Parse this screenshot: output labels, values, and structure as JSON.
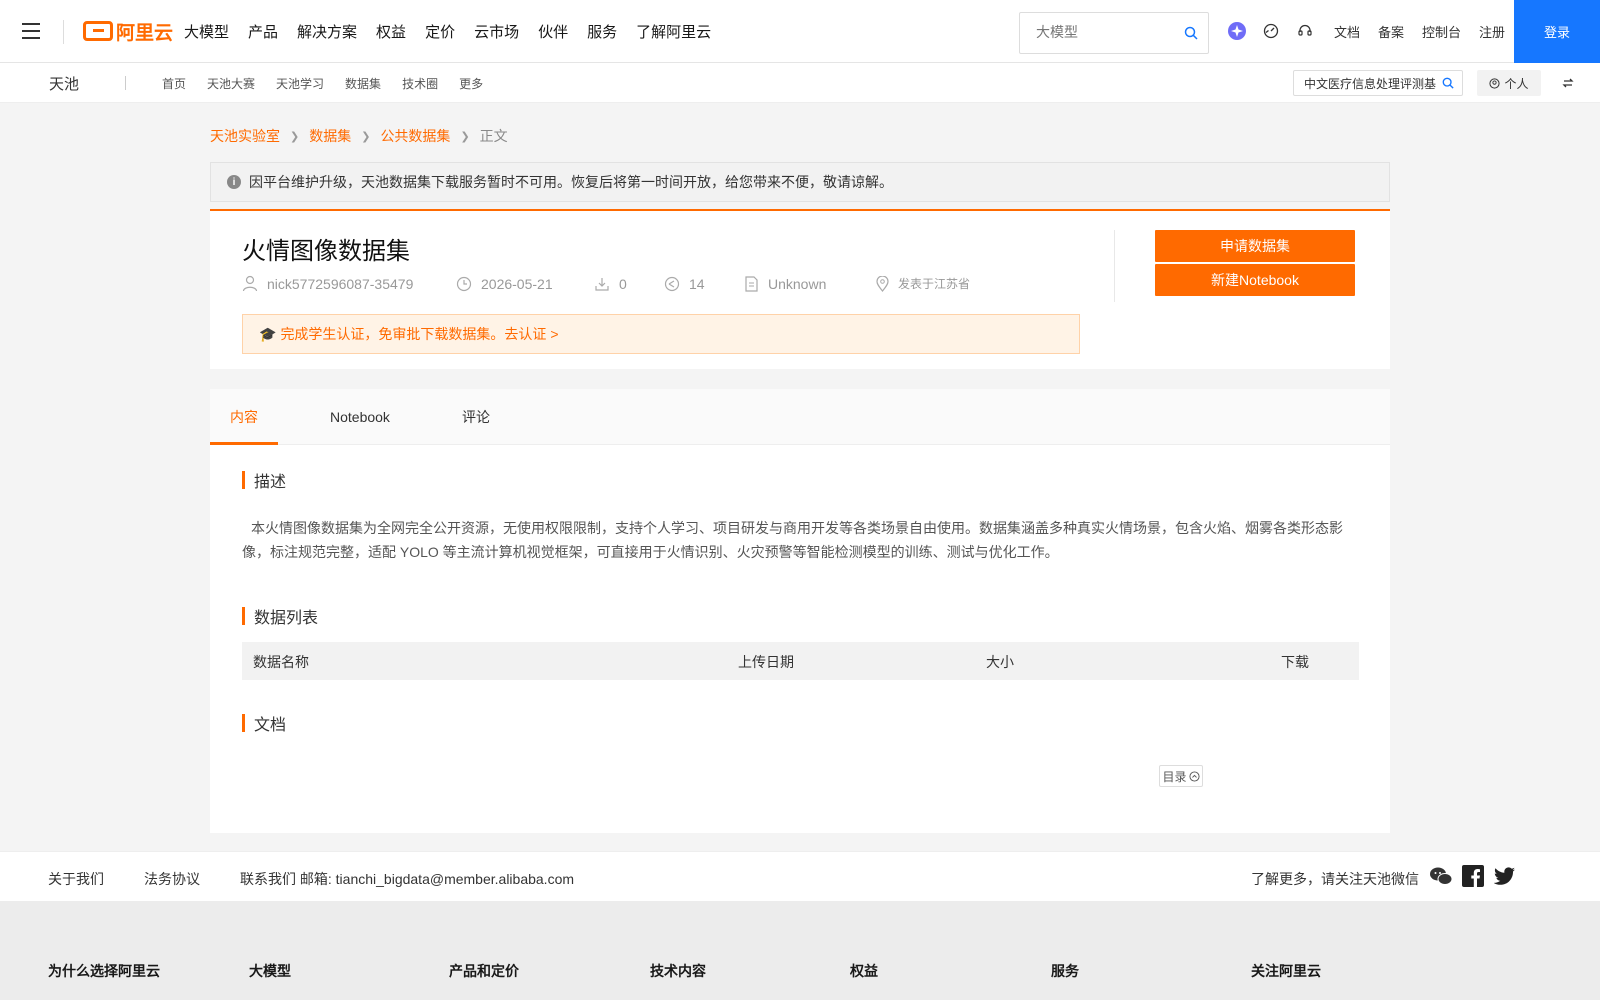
{
  "topnav": {
    "logo_text": "阿里云",
    "menu": [
      "大模型",
      "产品",
      "解决方案",
      "权益",
      "定价",
      "云市场",
      "伙伴",
      "服务",
      "了解阿里云"
    ],
    "search_placeholder": "大模型",
    "links": [
      "文档",
      "备案",
      "控制台",
      "注册"
    ],
    "login_label": "登录"
  },
  "subnav": {
    "brand": "天池",
    "menu": [
      "首页",
      "天池大赛",
      "天池学习",
      "数据集",
      "技术圈",
      "更多"
    ],
    "search_value": "中文医疗信息处理评测基",
    "personal_label": "个人"
  },
  "breadcrumb": [
    "天池实验室",
    "数据集",
    "公共数据集",
    "正文"
  ],
  "notice": "因平台维护升级，天池数据集下载服务暂时不可用。恢复后将第一时间开放，给您带来不便，敬请谅解。",
  "dataset": {
    "title": "火情图像数据集",
    "author": "nick5772596087-35479",
    "date": "2026-05-21",
    "downloads": "0",
    "shares": "14",
    "license": "Unknown",
    "location": "发表于江苏省",
    "apply_label": "申请数据集",
    "notebook_label": "新建Notebook",
    "cert_cap": "🎓",
    "cert_text": "完成学生认证，免审批下载数据集。去认证 >"
  },
  "tabs": [
    "内容",
    "Notebook",
    "评论"
  ],
  "sections": {
    "desc_title": "描述",
    "desc_text": "本火情图像数据集为全网完全公开资源，无使用权限限制，支持个人学习、项目研发与商用开发等各类场景自由使用。数据集涵盖多种真实火情场景，包含火焰、烟雾各类形态影像，标注规范完整，适配 YOLO 等主流计算机视觉框架，可直接用于火情识别、火灾预警等智能检测模型的训练、测试与优化工作。",
    "list_title": "数据列表",
    "table_headers": [
      "数据名称",
      "上传日期",
      "大小",
      "下载"
    ],
    "docs_title": "文档",
    "toc_label": "目录"
  },
  "footer": {
    "links": [
      "关于我们",
      "法务协议"
    ],
    "contact": "联系我们 邮箱: tianchi_bigdata@member.alibaba.com",
    "follow": "了解更多，请关注天池微信",
    "columns": [
      "为什么选择阿里云",
      "大模型",
      "产品和定价",
      "技术内容",
      "权益",
      "服务",
      "关注阿里云"
    ]
  },
  "colors": {
    "accent": "#ff6a00",
    "login": "#1677ff"
  }
}
